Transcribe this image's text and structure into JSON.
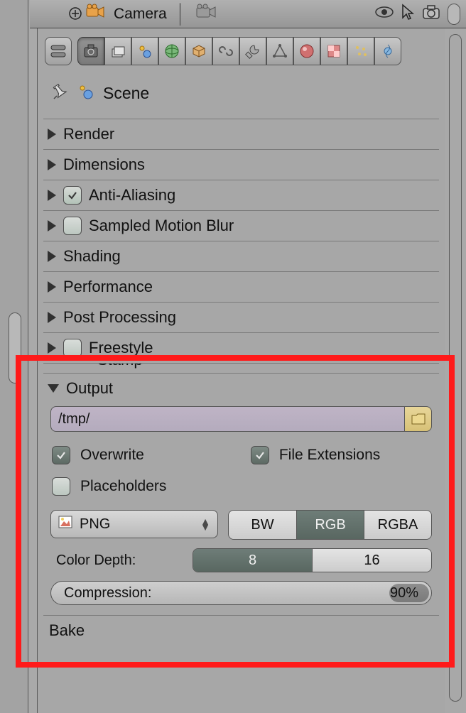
{
  "header": {
    "object_label": "Camera"
  },
  "context": {
    "datablock": "Scene"
  },
  "panels": {
    "render": "Render",
    "dimensions": "Dimensions",
    "antialiasing": "Anti-Aliasing",
    "motionblur": "Sampled Motion Blur",
    "shading": "Shading",
    "performance": "Performance",
    "postproc": "Post Processing",
    "freestyle": "Freestyle",
    "stamp": "Stamp",
    "output": "Output",
    "bake": "Bake"
  },
  "output": {
    "path": "/tmp/",
    "overwrite_label": "Overwrite",
    "fileext_label": "File Extensions",
    "placeholders_label": "Placeholders",
    "format": "PNG",
    "color_modes": {
      "bw": "BW",
      "rgb": "RGB",
      "rgba": "RGBA"
    },
    "color_depth_label": "Color Depth:",
    "depths": {
      "d8": "8",
      "d16": "16"
    },
    "compression_label": "Compression:",
    "compression_value": "90%"
  }
}
